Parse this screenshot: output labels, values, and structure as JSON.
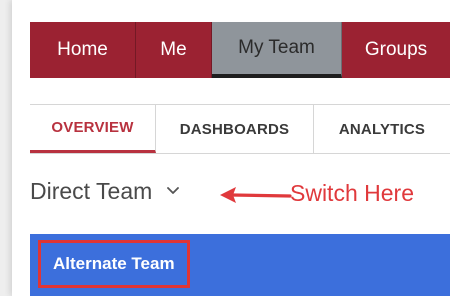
{
  "main_nav": {
    "items": [
      {
        "label": "Home"
      },
      {
        "label": "Me"
      },
      {
        "label": "My Team"
      },
      {
        "label": "Groups"
      }
    ]
  },
  "sub_tabs": {
    "items": [
      {
        "label": "OVERVIEW"
      },
      {
        "label": "DASHBOARDS"
      },
      {
        "label": "ANALYTICS"
      }
    ]
  },
  "team_selector": {
    "current": "Direct Team",
    "icon": "chevron-down-icon"
  },
  "annotation": {
    "text": "Switch Here",
    "color": "#e0393c"
  },
  "dropdown": {
    "option": "Alternate Team"
  },
  "colors": {
    "brand": "#9b2232",
    "active_nav": "#8f959b",
    "accent": "#b8323f",
    "dropdown_bg": "#3c6fdc",
    "highlight": "#e03535"
  }
}
